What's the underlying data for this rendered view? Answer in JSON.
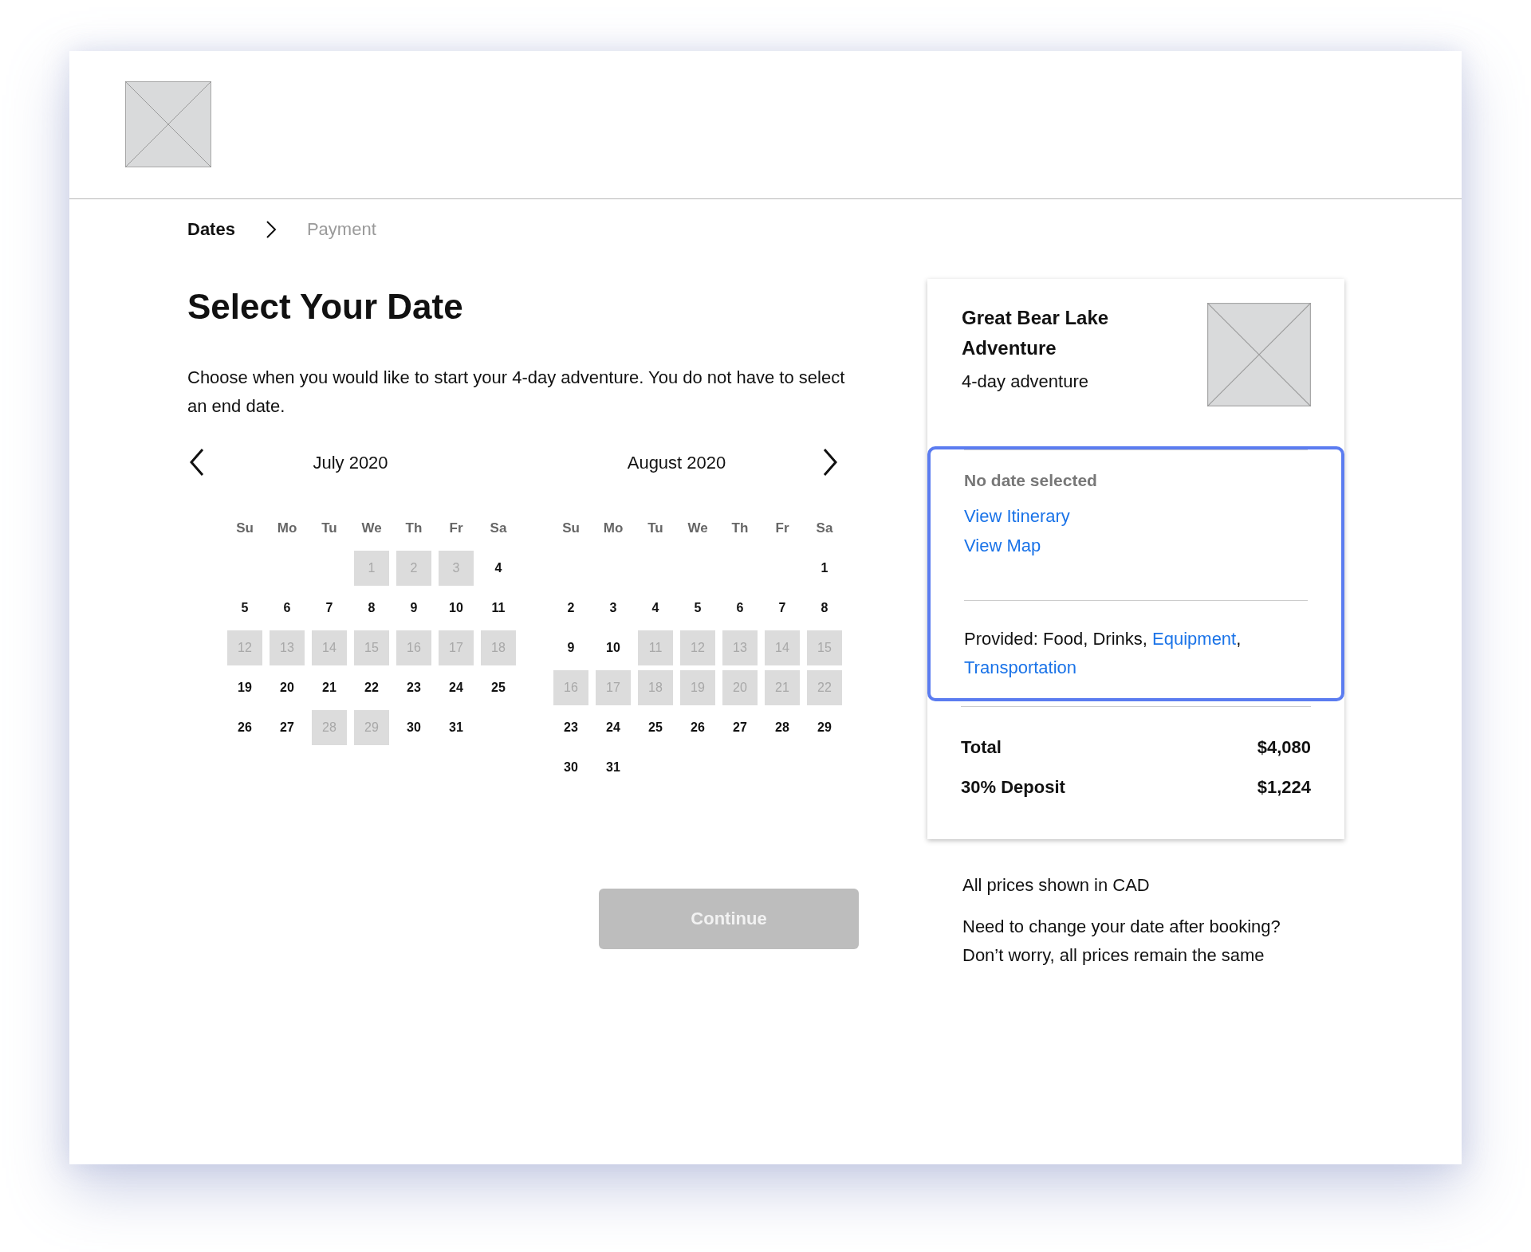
{
  "breadcrumb": [
    {
      "label": "Dates",
      "selected": true
    },
    {
      "label": "Payment",
      "selected": false
    }
  ],
  "title": "Select Your Date",
  "intro": "Choose when you would like to start your 4-day adventure. You do not have to select an end date.",
  "months": [
    {
      "title": "July 2020",
      "weekdays": [
        "Su",
        "Mo",
        "Tu",
        "We",
        "Th",
        "Fr",
        "Sa"
      ],
      "weeks": [
        {
          "leading_gap": true,
          "days": [
            {
              "day": "1",
              "unavailable": true
            },
            {
              "day": "2",
              "unavailable": true
            },
            {
              "day": "3",
              "unavailable": true
            },
            {
              "day": "4",
              "unavailable": false
            }
          ]
        },
        {
          "days": [
            {
              "day": "5",
              "unavailable": false
            },
            {
              "day": "6",
              "unavailable": false
            },
            {
              "day": "7",
              "unavailable": false
            },
            {
              "day": "8",
              "unavailable": false
            },
            {
              "day": "9",
              "unavailable": false
            },
            {
              "day": "10",
              "unavailable": false
            },
            {
              "day": "11",
              "unavailable": false
            }
          ]
        },
        {
          "days": [
            {
              "day": "12",
              "unavailable": true
            },
            {
              "day": "13",
              "unavailable": true
            },
            {
              "day": "14",
              "unavailable": true
            },
            {
              "day": "15",
              "unavailable": true
            },
            {
              "day": "16",
              "unavailable": true
            },
            {
              "day": "17",
              "unavailable": true
            },
            {
              "day": "18",
              "unavailable": true
            }
          ]
        },
        {
          "days": [
            {
              "day": "19",
              "unavailable": false
            },
            {
              "day": "20",
              "unavailable": false
            },
            {
              "day": "21",
              "unavailable": false
            },
            {
              "day": "22",
              "unavailable": false
            },
            {
              "day": "23",
              "unavailable": false
            },
            {
              "day": "24",
              "unavailable": false
            },
            {
              "day": "25",
              "unavailable": false
            }
          ]
        },
        {
          "days": [
            {
              "day": "26",
              "unavailable": false
            },
            {
              "day": "27",
              "unavailable": false
            },
            {
              "day": "28",
              "unavailable": true
            },
            {
              "day": "29",
              "unavailable": true
            },
            {
              "day": "30",
              "unavailable": false
            },
            {
              "day": "31",
              "unavailable": false
            }
          ]
        }
      ]
    },
    {
      "title": "August 2020",
      "weekdays": [
        "Su",
        "Mo",
        "Tu",
        "We",
        "Th",
        "Fr",
        "Sa"
      ],
      "weeks": [
        {
          "leading_gap": true,
          "days": [
            {
              "day": "1",
              "unavailable": false
            }
          ]
        },
        {
          "days": [
            {
              "day": "2",
              "unavailable": false
            },
            {
              "day": "3",
              "unavailable": false
            },
            {
              "day": "4",
              "unavailable": false
            },
            {
              "day": "5",
              "unavailable": false
            },
            {
              "day": "6",
              "unavailable": false
            },
            {
              "day": "7",
              "unavailable": false
            },
            {
              "day": "8",
              "unavailable": false
            }
          ]
        },
        {
          "days": [
            {
              "day": "9",
              "unavailable": false
            },
            {
              "day": "10",
              "unavailable": false
            },
            {
              "day": "11",
              "unavailable": true
            },
            {
              "day": "12",
              "unavailable": true
            },
            {
              "day": "13",
              "unavailable": true
            },
            {
              "day": "14",
              "unavailable": true
            },
            {
              "day": "15",
              "unavailable": true
            }
          ]
        },
        {
          "days": [
            {
              "day": "16",
              "unavailable": true
            },
            {
              "day": "17",
              "unavailable": true
            },
            {
              "day": "18",
              "unavailable": true
            },
            {
              "day": "19",
              "unavailable": true
            },
            {
              "day": "20",
              "unavailable": true
            },
            {
              "day": "21",
              "unavailable": true
            },
            {
              "day": "22",
              "unavailable": true
            }
          ]
        },
        {
          "days": [
            {
              "day": "23",
              "unavailable": false
            },
            {
              "day": "24",
              "unavailable": false
            },
            {
              "day": "25",
              "unavailable": false
            },
            {
              "day": "26",
              "unavailable": false
            },
            {
              "day": "27",
              "unavailable": false
            },
            {
              "day": "28",
              "unavailable": false
            },
            {
              "day": "29",
              "unavailable": false
            }
          ]
        },
        {
          "days": [
            {
              "day": "30",
              "unavailable": false
            },
            {
              "day": "31",
              "unavailable": false
            }
          ]
        }
      ]
    }
  ],
  "continue_button": {
    "label": "Continue",
    "disabled": true
  },
  "summary": {
    "title": "Great Bear Lake Adventure",
    "subtitle": "4-day adventure",
    "details": {
      "highlighted": true,
      "status": "No date selected",
      "links": [
        "View Itinerary",
        "View Map"
      ],
      "provided_label": "Provided:",
      "provided": [
        {
          "text": "Food,",
          "link": false
        },
        {
          "text": "Drinks,",
          "link": false
        },
        {
          "text": "Equipment",
          "link": true,
          "suffix": ","
        },
        {
          "text": "Transportation",
          "link": true
        }
      ]
    },
    "prices": [
      {
        "label": "Total",
        "value": "$4,080"
      },
      {
        "label": "30% Deposit",
        "value": "$1,224"
      }
    ]
  },
  "notes": [
    "All prices shown in CAD",
    "Need to change your date after booking? Don’t worry, all prices remain the same"
  ]
}
